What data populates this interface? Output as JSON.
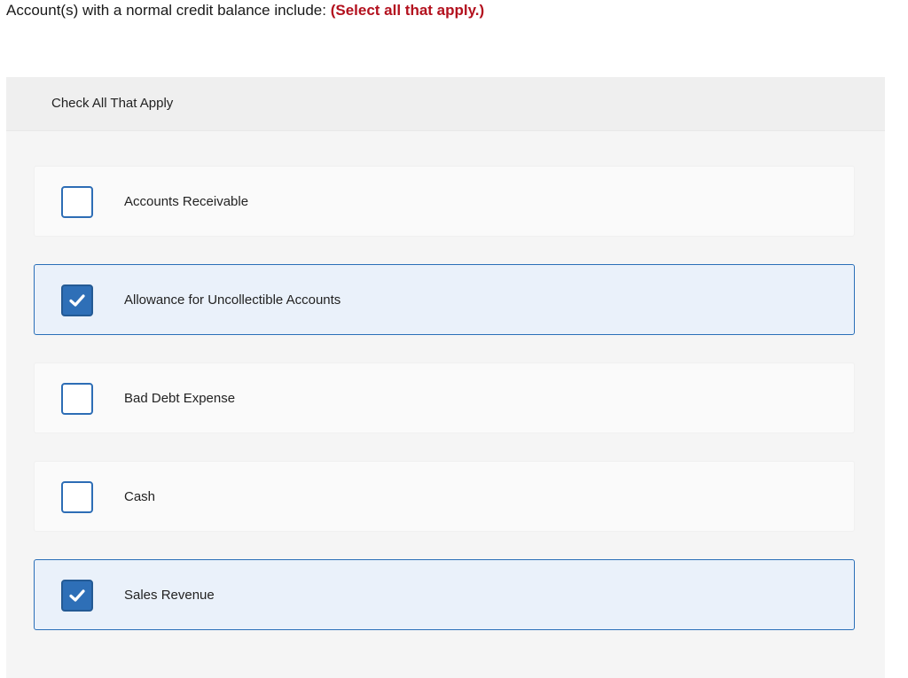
{
  "question": {
    "text": "Account(s) with a normal credit balance include:",
    "instruction": "(Select all that apply.)"
  },
  "panel": {
    "header_title": "Check All That Apply"
  },
  "options": [
    {
      "label": "Accounts Receivable",
      "checked": false
    },
    {
      "label": "Allowance for Uncollectible Accounts",
      "checked": true
    },
    {
      "label": "Bad Debt Expense",
      "checked": false
    },
    {
      "label": "Cash",
      "checked": false
    },
    {
      "label": "Sales Revenue",
      "checked": true
    }
  ],
  "colors": {
    "instruction": "#b3111e",
    "checkbox_border": "#2d6db5",
    "checked_fill": "#2e6fb7",
    "checked_row_bg": "#eaf1fa",
    "checked_row_border": "#2a6fb8"
  },
  "icons": {
    "checked": "checkmark-icon"
  }
}
